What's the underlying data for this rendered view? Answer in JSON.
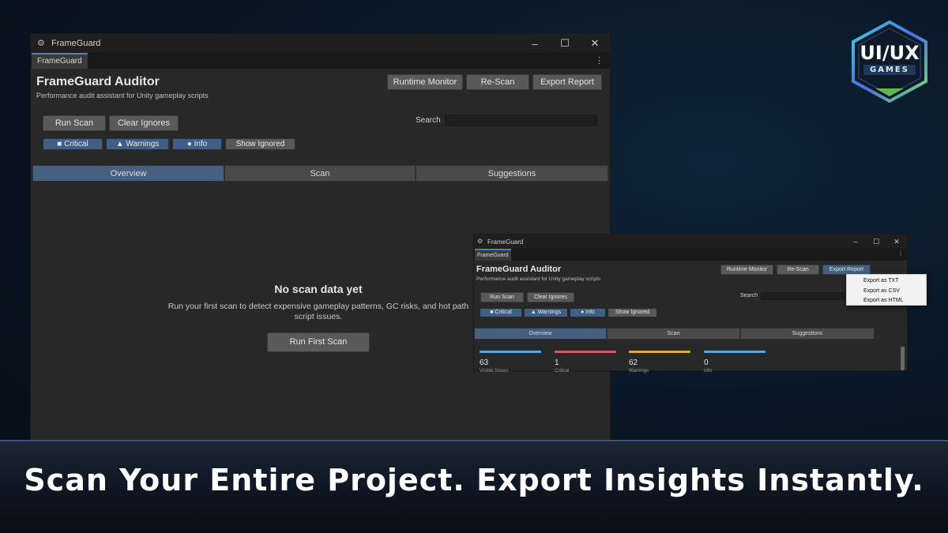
{
  "main_window": {
    "title": "FrameGuard",
    "tab": "FrameGuard",
    "heading": "FrameGuard Auditor",
    "subheading": "Performance audit assistant for Unity gameplay scripts",
    "toolbar": {
      "runtime_monitor": "Runtime Monitor",
      "rescan": "Re-Scan",
      "export_report": "Export Report"
    },
    "actions": {
      "run_scan": "Run Scan",
      "clear_ignores": "Clear Ignores"
    },
    "search_label": "Search",
    "filters": {
      "critical": "Critical",
      "warnings": "Warnings",
      "info": "Info",
      "show_ignored": "Show Ignored"
    },
    "tabs": {
      "overview": "Overview",
      "scan": "Scan",
      "suggestions": "Suggestions"
    },
    "empty": {
      "title": "No scan data yet",
      "message": "Run your first scan to detect expensive gameplay patterns, GC risks, and hot path script issues.",
      "button": "Run First Scan"
    }
  },
  "second_window": {
    "title": "FrameGuard",
    "tab": "FrameGuard",
    "heading": "FrameGuard Auditor",
    "subheading": "Performance audit assistant for Unity gameplay scripts",
    "toolbar": {
      "runtime_monitor": "Runtime Monitor",
      "rescan": "Re-Scan",
      "export_report": "Export Report"
    },
    "actions": {
      "run_scan": "Run Scan",
      "clear_ignores": "Clear Ignores"
    },
    "search_label": "Search",
    "filters": {
      "critical": "Critical",
      "warnings": "Warnings",
      "info": "Info",
      "show_ignored": "Show Ignored"
    },
    "tabs": {
      "overview": "Overview",
      "scan": "Scan",
      "suggestions": "Suggestions"
    },
    "export_menu": [
      "Export as TXT",
      "Export as CSV",
      "Export as HTML"
    ],
    "stats": [
      {
        "value": "63",
        "label": "Visible Issues",
        "color": "#5aa7e0"
      },
      {
        "value": "1",
        "label": "Critical",
        "color": "#d65c5c"
      },
      {
        "value": "62",
        "label": "Warnings",
        "color": "#e0a93a"
      },
      {
        "value": "0",
        "label": "Info",
        "color": "#5aa7e0"
      }
    ]
  },
  "logo": {
    "line1": "UI/UX",
    "line2": "GAMES"
  },
  "caption": "Scan Your Entire Project. Export Insights Instantly.",
  "colors": {
    "accent": "#4d7fb8",
    "filter_on": "#3f5f86",
    "tab_active": "#46607f"
  }
}
